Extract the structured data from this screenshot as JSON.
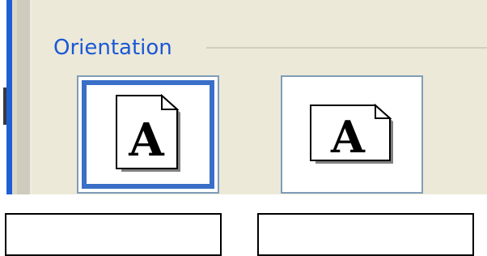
{
  "group": {
    "title": "Orientation"
  },
  "orientation_options": [
    {
      "name": "portrait",
      "glyph": "A",
      "selected": true
    },
    {
      "name": "landscape",
      "glyph": "A",
      "selected": false
    }
  ],
  "colors": {
    "title": "#1a58d6",
    "selection": "#3a6fc7",
    "button_border": "#7f9db9",
    "panel": "#ece9d8"
  },
  "fields": {
    "field_1_value": "",
    "field_2_value": ""
  }
}
